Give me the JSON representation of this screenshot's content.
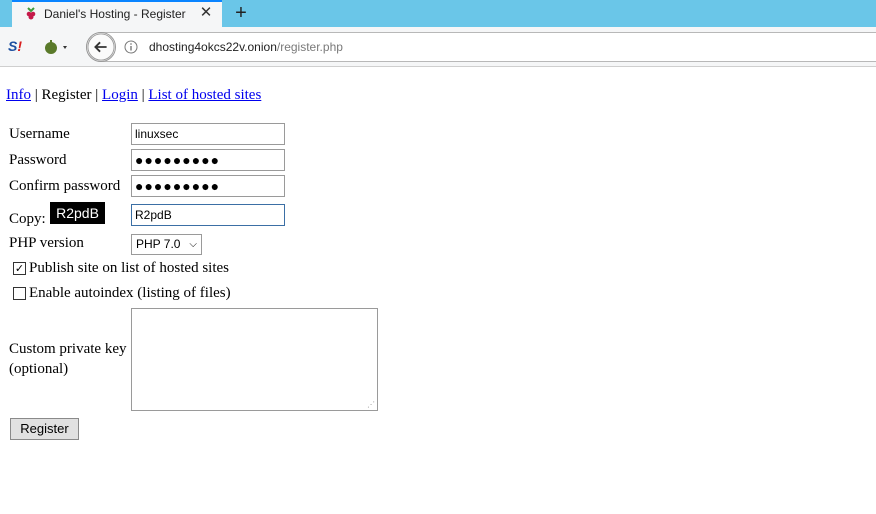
{
  "browser": {
    "tab_title": "Daniel's Hosting - Register",
    "tab_close": "✕",
    "new_tab": "+",
    "url_host": "dhosting4okcs22v.onion",
    "url_path": "/register.php",
    "accent_color": "#0a84ff",
    "tabbar_color": "#6ac6e8"
  },
  "nav": {
    "info": "Info",
    "register": "Register",
    "login": "Login",
    "hosted": "List of hosted sites",
    "sep": "|"
  },
  "form": {
    "username_label": "Username",
    "username_value": "linuxsec",
    "password_label": "Password",
    "password_value": "●●●●●●●●●",
    "confirm_label": "Confirm password",
    "confirm_value": "●●●●●●●●●",
    "copy_label": "Copy:",
    "captcha_text": "R2pdB",
    "captcha_value": "R2pdB",
    "php_label": "PHP version",
    "php_value": "PHP 7.0",
    "publish_label": "Publish site on list of hosted sites",
    "publish_checked": true,
    "autoindex_label": "Enable autoindex (listing of files)",
    "autoindex_checked": false,
    "key_label_1": "Custom private key",
    "key_label_2": "(optional)",
    "register_button": "Register"
  }
}
